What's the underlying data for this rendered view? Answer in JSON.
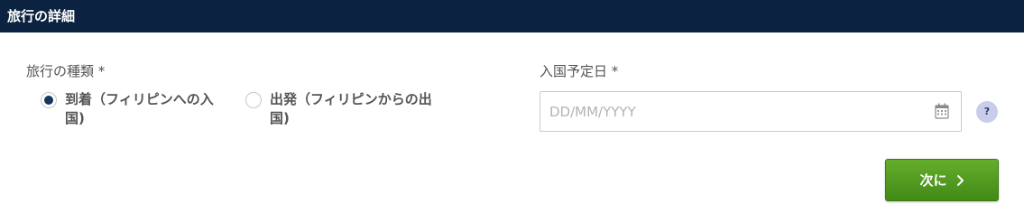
{
  "header": {
    "title": "旅行の詳細"
  },
  "trip_type": {
    "label": "旅行の種類 *",
    "options": [
      {
        "label": "到着（フィリピンへの入国)",
        "selected": true
      },
      {
        "label": "出発（フィリピンからの出国)",
        "selected": false
      }
    ]
  },
  "entry_date": {
    "label": "入国予定日 *",
    "placeholder": "DD/MM/YYYY",
    "value": ""
  },
  "help": {
    "icon": "help-icon",
    "text": "?"
  },
  "next_button": {
    "label": "次に",
    "icon": "chevron-right-icon"
  },
  "colors": {
    "header_bg": "#0b2340",
    "radio_selected": "#14375f",
    "button_green": "#4f9a1f",
    "help_bg": "#c9cdeb"
  }
}
